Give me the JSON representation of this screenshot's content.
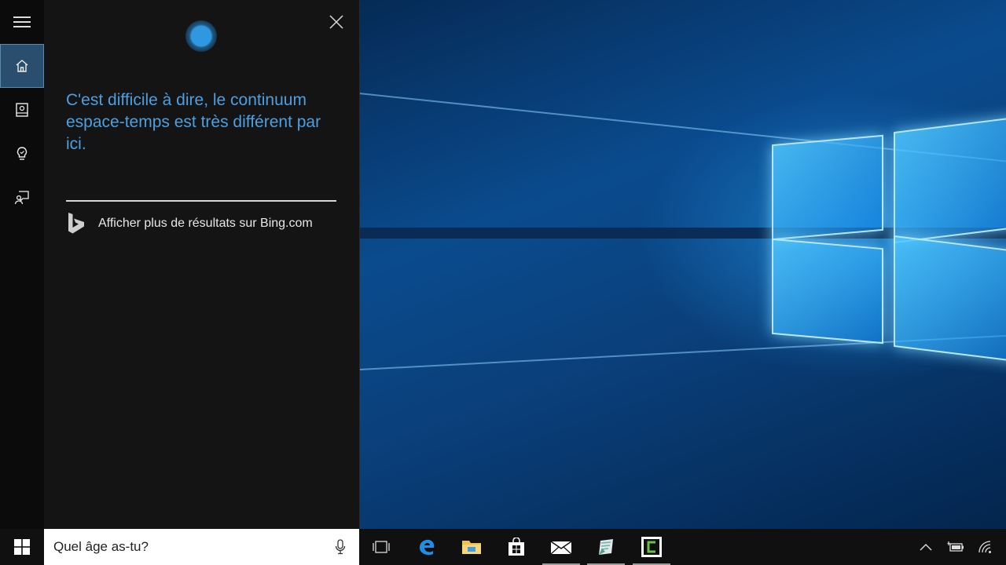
{
  "cortana": {
    "answer_text": "C'est difficile à dire, le continuum espace-temps est très différent par ici.",
    "bing_link_label": "Afficher plus de résultats sur Bing.com",
    "nav_items": [
      {
        "name": "menu-button",
        "icon": "hamburger-icon"
      },
      {
        "name": "home-button",
        "icon": "home-icon",
        "active": true
      },
      {
        "name": "notebook-button",
        "icon": "notebook-icon"
      },
      {
        "name": "reminders-button",
        "icon": "lightbulb-icon"
      },
      {
        "name": "feedback-button",
        "icon": "feedback-icon"
      }
    ]
  },
  "search": {
    "value": "Quel âge as-tu?"
  },
  "taskbar": {
    "apps": [
      {
        "name": "task-view",
        "icon": "task-view-icon"
      },
      {
        "name": "edge",
        "icon": "edge-icon"
      },
      {
        "name": "file-explorer",
        "icon": "folder-icon"
      },
      {
        "name": "store",
        "icon": "store-icon"
      },
      {
        "name": "mail",
        "icon": "mail-icon",
        "running": true
      },
      {
        "name": "app-green",
        "icon": "document-app-icon",
        "running": true
      },
      {
        "name": "app-camtasia",
        "icon": "camtasia-icon",
        "running": true
      }
    ],
    "tray": [
      {
        "name": "show-hidden-icons",
        "icon": "chevron-up-icon"
      },
      {
        "name": "battery",
        "icon": "battery-icon"
      },
      {
        "name": "network",
        "icon": "wifi-icon"
      }
    ]
  },
  "colors": {
    "cortana_text": "#4d9fe0",
    "accent": "#2a4e6e",
    "panel_bg": "#141414",
    "taskbar_bg": "#101010"
  }
}
